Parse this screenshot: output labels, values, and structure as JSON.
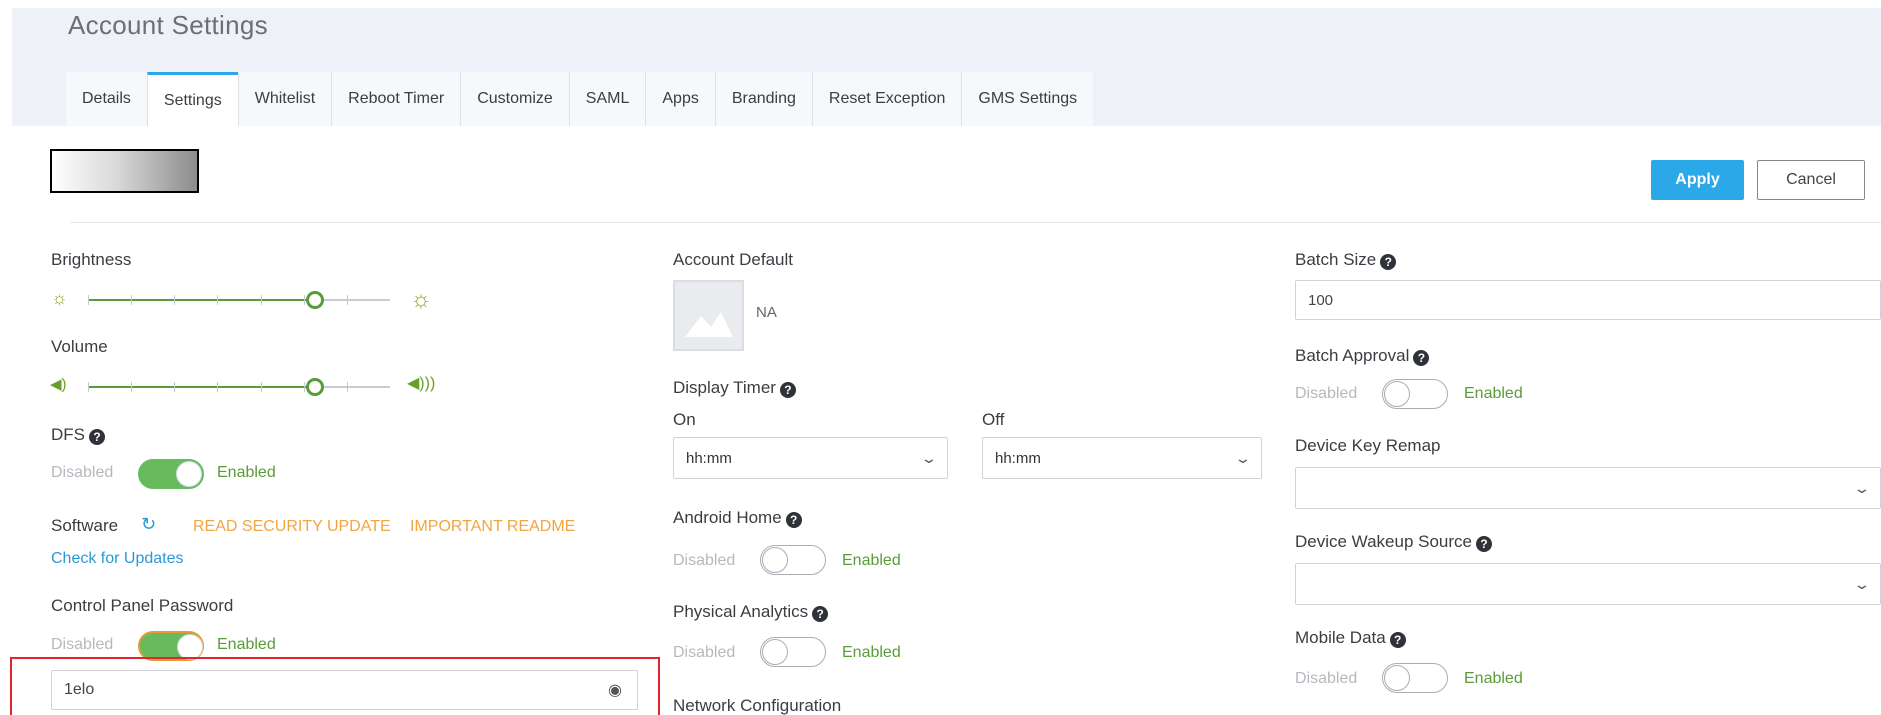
{
  "page": {
    "title": "Account Settings"
  },
  "tabs": [
    {
      "label": "Details"
    },
    {
      "label": "Settings",
      "active": true
    },
    {
      "label": "Whitelist"
    },
    {
      "label": "Reboot Timer"
    },
    {
      "label": "Customize"
    },
    {
      "label": "SAML"
    },
    {
      "label": "Apps"
    },
    {
      "label": "Branding"
    },
    {
      "label": "Reset Exception"
    },
    {
      "label": "GMS Settings"
    }
  ],
  "actions": {
    "apply": "Apply",
    "cancel": "Cancel"
  },
  "toggle_text": {
    "off": "Disabled",
    "on": "Enabled"
  },
  "left": {
    "brightness": {
      "label": "Brightness",
      "level": 0.75,
      "ticks": 7
    },
    "volume": {
      "label": "Volume",
      "level": 0.75,
      "ticks": 7
    },
    "dfs": {
      "label": "DFS",
      "state": "on"
    },
    "software": {
      "label": "Software",
      "security_link": "READ SECURITY UPDATE",
      "readme_link": "IMPORTANT README",
      "check_updates": "Check for Updates"
    },
    "control_panel_password": {
      "label": "Control Panel Password",
      "state": "on",
      "value": "1elo"
    }
  },
  "middle": {
    "account_default": {
      "label": "Account Default",
      "image_text": "NA"
    },
    "display_timer": {
      "label": "Display Timer",
      "on_label": "On",
      "off_label": "Off",
      "on_value": "hh:mm",
      "off_value": "hh:mm"
    },
    "android_home": {
      "label": "Android Home",
      "state": "off"
    },
    "physical_analytics": {
      "label": "Physical Analytics",
      "state": "off"
    },
    "network_configuration": {
      "label": "Network Configuration"
    }
  },
  "right": {
    "batch_size": {
      "label": "Batch Size",
      "value": "100"
    },
    "batch_approval": {
      "label": "Batch Approval",
      "state": "off"
    },
    "device_key_remap": {
      "label": "Device Key Remap",
      "value": ""
    },
    "device_wakeup_source": {
      "label": "Device Wakeup Source",
      "value": ""
    },
    "mobile_data": {
      "label": "Mobile Data",
      "state": "off"
    }
  },
  "colors": {
    "accent": "#2aa8e8",
    "toggle_on": "#67bb5c",
    "enabled_text": "#5a9b3a",
    "link_orange": "#f2a541",
    "highlight_border": "#e0262b"
  }
}
